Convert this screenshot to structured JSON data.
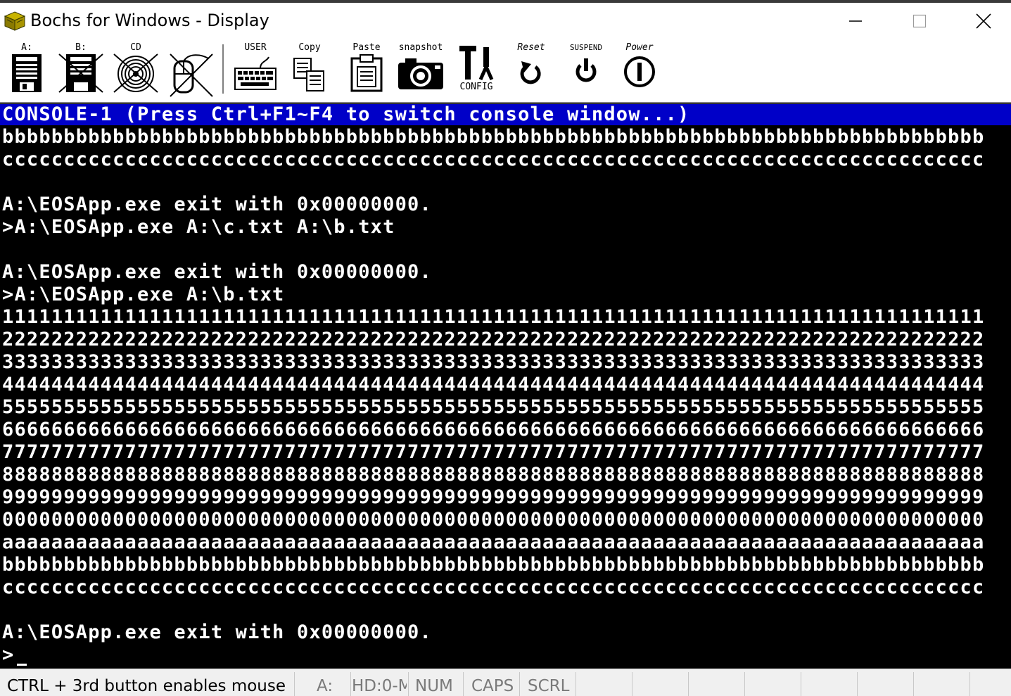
{
  "window": {
    "title": "Bochs for Windows - Display"
  },
  "toolbar": {
    "floppy_a_label": "A:",
    "floppy_b_label": "B:",
    "cdrom_label": "CD",
    "mouse_label": "",
    "user_label": "USER",
    "copy_label": "Copy",
    "paste_label": "Paste",
    "snapshot_label": "snapshot",
    "config_label": "CONFIG",
    "reset_label": "Reset",
    "suspend_label": "SUSPEND",
    "power_label": "Power"
  },
  "console": {
    "header": "CONSOLE-1 (Press Ctrl+F1~F4 to switch console window...)",
    "lines": [
      "bbbbbbbbbbbbbbbbbbbbbbbbbbbbbbbbbbbbbbbbbbbbbbbbbbbbbbbbbbbbbbbbbbbbbbbbbbbbbbbb",
      "cccccccccccccccccccccccccccccccccccccccccccccccccccccccccccccccccccccccccccccccc",
      "",
      "A:\\EOSApp.exe exit with 0x00000000.",
      ">A:\\EOSApp.exe A:\\c.txt A:\\b.txt",
      "",
      "A:\\EOSApp.exe exit with 0x00000000.",
      ">A:\\EOSApp.exe A:\\b.txt",
      "11111111111111111111111111111111111111111111111111111111111111111111111111111111",
      "22222222222222222222222222222222222222222222222222222222222222222222222222222222",
      "33333333333333333333333333333333333333333333333333333333333333333333333333333333",
      "44444444444444444444444444444444444444444444444444444444444444444444444444444444",
      "55555555555555555555555555555555555555555555555555555555555555555555555555555555",
      "66666666666666666666666666666666666666666666666666666666666666666666666666666666",
      "77777777777777777777777777777777777777777777777777777777777777777777777777777777",
      "88888888888888888888888888888888888888888888888888888888888888888888888888888888",
      "99999999999999999999999999999999999999999999999999999999999999999999999999999999",
      "00000000000000000000000000000000000000000000000000000000000000000000000000000000",
      "aaaaaaaaaaaaaaaaaaaaaaaaaaaaaaaaaaaaaaaaaaaaaaaaaaaaaaaaaaaaaaaaaaaaaaaaaaaaaaaa",
      "bbbbbbbbbbbbbbbbbbbbbbbbbbbbbbbbbbbbbbbbbbbbbbbbbbbbbbbbbbbbbbbbbbbbbbbbbbbbbbbb",
      "cccccccccccccccccccccccccccccccccccccccccccccccccccccccccccccccccccccccccccccccc",
      "",
      "A:\\EOSApp.exe exit with 0x00000000.",
      ">"
    ]
  },
  "statusbar": {
    "mouse_hint": "CTRL + 3rd button enables mouse",
    "drive": "A:",
    "hd": "HD:0-M",
    "num": "NUM",
    "caps": "CAPS",
    "scrl": "SCRL"
  }
}
